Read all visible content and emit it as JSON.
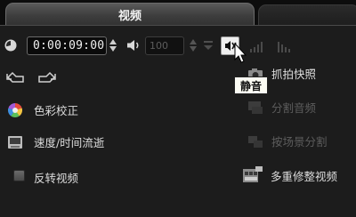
{
  "tabs": {
    "active_label": "视频",
    "inactive_label": ""
  },
  "playback": {
    "timecode": "0:00:09:00",
    "volume": "100"
  },
  "audio_buttons": {
    "mute_tooltip": "静音"
  },
  "left_items": {
    "color_correction": "色彩校正",
    "speed_time_lapse": "速度/时间流逝",
    "reverse_video": "反转视频"
  },
  "right_items": {
    "snapshot": "抓拍快照",
    "split_audio": "分割音频",
    "split_by_scene": "按场景分割",
    "multi_trim_video": "多重修整视频"
  },
  "icons": {
    "clock": "clock-icon",
    "speaker": "speaker-icon",
    "mute": "mute-icon",
    "fade_in": "fade-in-icon",
    "fade_out": "fade-out-icon",
    "rotate_left": "rotate-left-icon",
    "rotate_right": "rotate-right-icon",
    "color_wheel": "color-wheel-icon",
    "speed": "speed-icon",
    "snapshot": "camera-icon",
    "split_audio": "split-audio-icon",
    "split_scene": "split-scene-icon",
    "multi_trim": "film-trim-icon"
  },
  "colors": {
    "background": "#1c1c1c",
    "text": "#dcdcdc",
    "disabled_text": "#5d5d5d",
    "tooltip_bg": "#fbfbf3"
  }
}
